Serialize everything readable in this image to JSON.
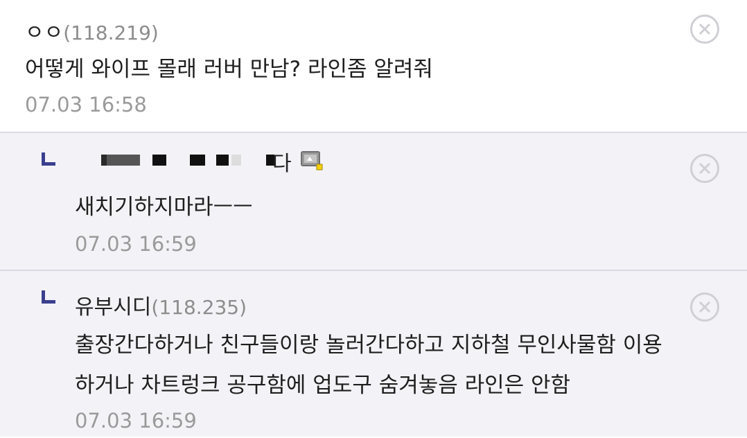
{
  "comments": [
    {
      "author": "ㅇㅇ",
      "ip": "(118.219)",
      "text": "어떻게 와이프 몰래 러버 만남? 라인좀 알려줘",
      "time": "07.03 16:58",
      "delete_icon": "close-circle-icon"
    },
    {
      "author_tail": "다",
      "author_icon": "gallery-user-icon",
      "text": "새치기하지마라ㅡㅡ",
      "time": "07.03 16:59",
      "reply_icon": "reply-corner-icon",
      "delete_icon": "close-circle-icon"
    },
    {
      "author": "유부시디",
      "ip": "(118.235)",
      "text_lines": [
        "출장간다하거나 친구들이랑 놀러간다하고 지하철 무인사물함 이용",
        "하거나 차트렁크 공구함에 업도구 숨겨놓음 라인은 안함"
      ],
      "time": "07.03 16:59",
      "reply_icon": "reply-corner-icon",
      "delete_icon": "close-circle-icon"
    }
  ],
  "colors": {
    "reply_background": "#f3f3f7",
    "reply_arrow": "#3b3f8f",
    "timestamp": "#9a9a9a",
    "ip": "#8c8c8c",
    "divider": "#d9dae6"
  }
}
